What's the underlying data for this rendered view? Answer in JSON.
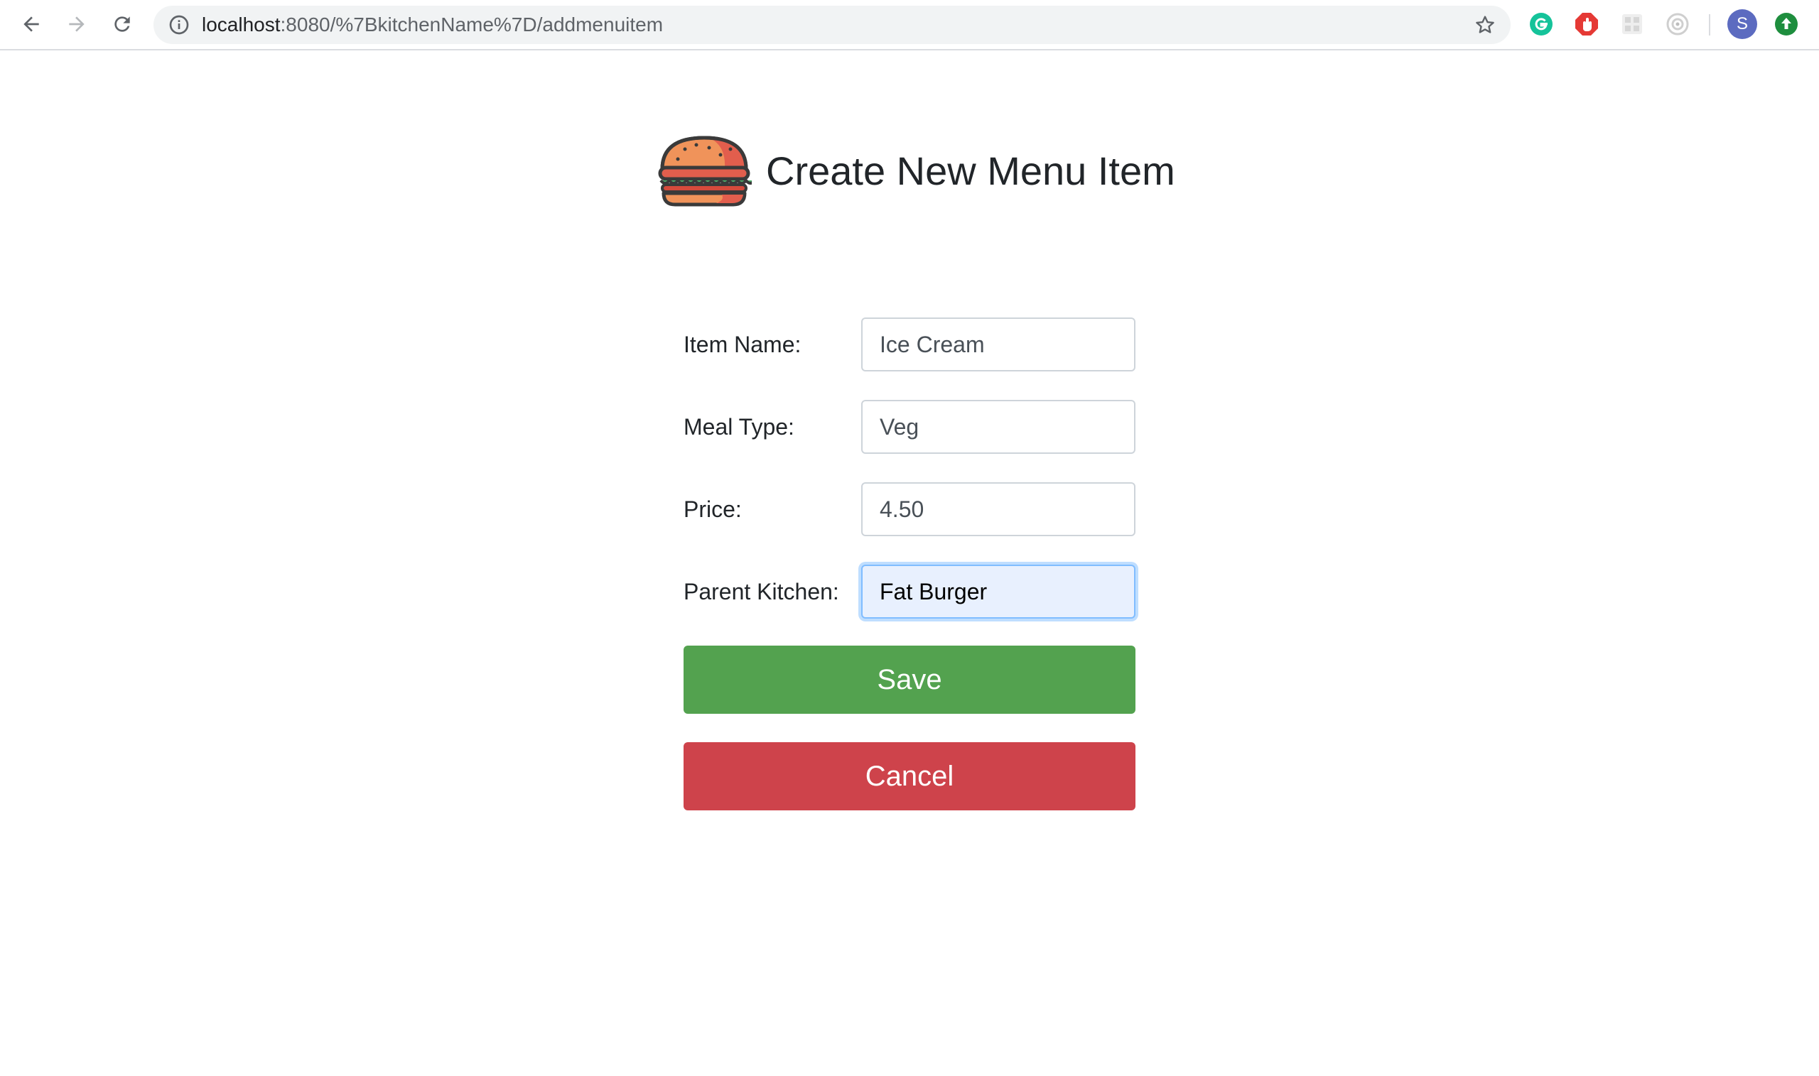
{
  "browser": {
    "url_host": "localhost",
    "url_path": ":8080/%7BkitchenName%7D/addmenuitem",
    "profile_initial": "S",
    "extensions": [
      "grammarly-icon",
      "adblock-icon",
      "extension-grid-icon",
      "extension-target-icon"
    ],
    "nav_icons": [
      "back-arrow-icon",
      "forward-arrow-icon",
      "reload-icon"
    ]
  },
  "page": {
    "title": "Create New Menu Item",
    "logo_icon": "burger-icon"
  },
  "form": {
    "item_name": {
      "label": "Item Name:",
      "value": "Ice Cream"
    },
    "meal_type": {
      "label": "Meal Type:",
      "value": "Veg"
    },
    "price": {
      "label": "Price:",
      "value": "4.50"
    },
    "parent_kitchen": {
      "label": "Parent Kitchen:",
      "value": "Fat Burger"
    }
  },
  "buttons": {
    "save": "Save",
    "cancel": "Cancel"
  },
  "colors": {
    "save": "#53a24f",
    "cancel": "#ce434b",
    "focused_input": "#e8f0fe",
    "avatar": "#5c6bc0"
  }
}
